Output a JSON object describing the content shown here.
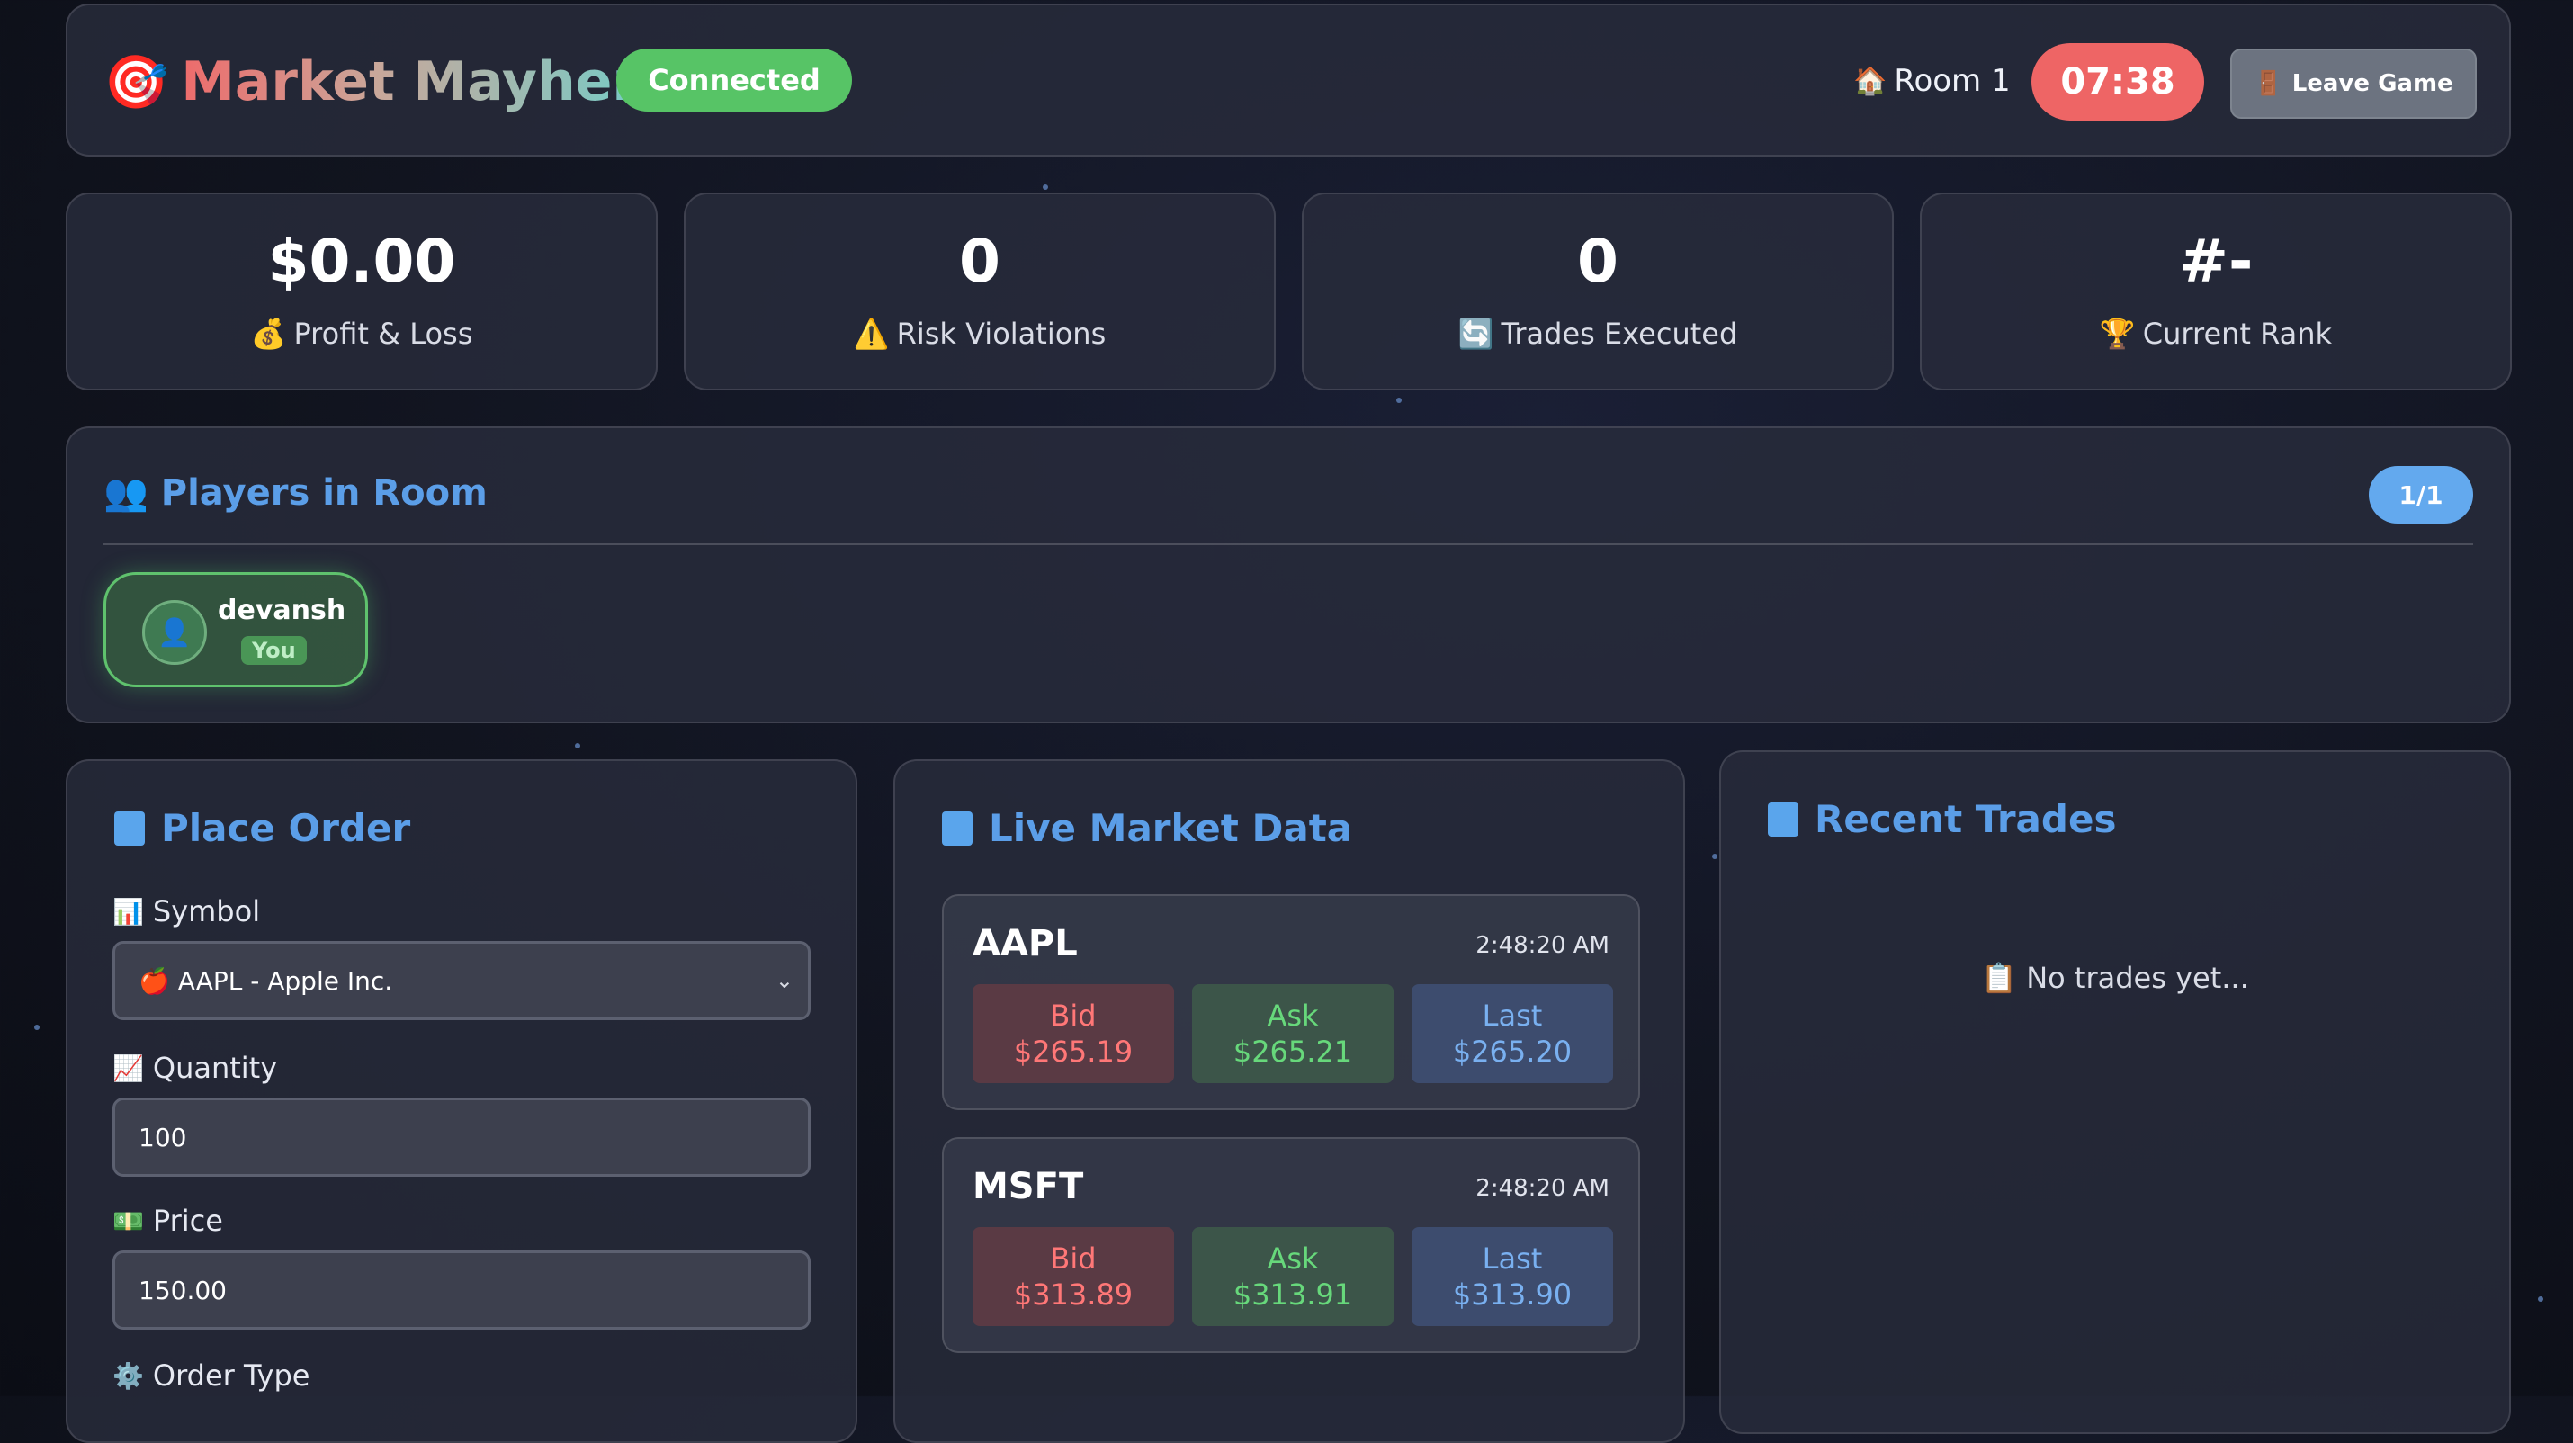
{
  "header": {
    "title": "Market Mayhem",
    "status": "Connected",
    "room": "Room 1",
    "timer": "07:38",
    "leave_label": "Leave Game"
  },
  "stats": [
    {
      "value": "$0.00",
      "label": "Profit & Loss",
      "icon": "money-bag-icon"
    },
    {
      "value": "0",
      "label": "Risk Violations",
      "icon": "warning-icon"
    },
    {
      "value": "0",
      "label": "Trades Executed",
      "icon": "refresh-icon"
    },
    {
      "value": "#-",
      "label": "Current Rank",
      "icon": "trophy-icon"
    }
  ],
  "players": {
    "title": "Players in Room",
    "count": "1/1",
    "list": [
      {
        "name": "devansh",
        "badge": "You"
      }
    ]
  },
  "order": {
    "title": "Place Order",
    "symbol_label": "Symbol",
    "symbol_value": "🍎 AAPL - Apple Inc.",
    "quantity_label": "Quantity",
    "quantity_value": "100",
    "price_label": "Price",
    "price_value": "150.00",
    "order_type_label": "Order Type"
  },
  "market": {
    "title": "Live Market Data",
    "bid_label": "Bid",
    "ask_label": "Ask",
    "last_label": "Last",
    "items": [
      {
        "symbol": "AAPL",
        "time": "2:48:20 AM",
        "bid": "$265.19",
        "ask": "$265.21",
        "last": "$265.20"
      },
      {
        "symbol": "MSFT",
        "time": "2:48:20 AM",
        "bid": "$313.89",
        "ask": "$313.91",
        "last": "$313.90"
      }
    ]
  },
  "trades": {
    "title": "Recent Trades",
    "empty": "📋 No trades yet..."
  },
  "colors": {
    "accent": "#5b9ee8",
    "connected": "#57c466",
    "timer": "#ee6565",
    "bid": "#ff7777",
    "ask": "#67d87b",
    "last": "#79b0f0"
  }
}
